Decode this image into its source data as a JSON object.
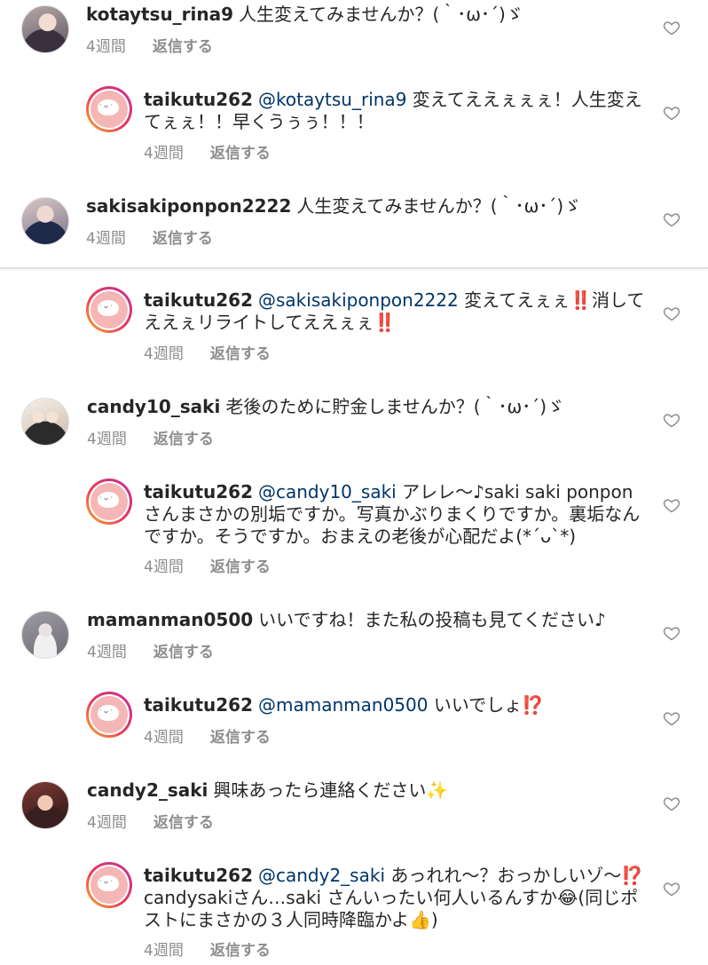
{
  "comments": [
    {
      "username": "kotaytsu_rina9",
      "text": "人生変えてみませんか？(｀･ω･´)ゞ",
      "time": "4週間",
      "reply_label": "返信する"
    },
    {
      "username": "taikutu262",
      "mention": "@kotaytsu_rina9",
      "text": "変えてええぇぇぇ！人生変えてぇぇ！！早くうぅぅ！！！",
      "time": "4週間",
      "reply_label": "返信する"
    },
    {
      "username": "sakisakiponpon2222",
      "text": "人生変えてみませんか？(｀･ω･´)ゞ",
      "time": "4週間",
      "reply_label": "返信する"
    },
    {
      "username": "taikutu262",
      "mention": "@sakisakiponpon2222",
      "text": "変えてえぇぇ‼️消してええぇリライトしてええぇぇ‼️",
      "time": "4週間",
      "reply_label": "返信する"
    },
    {
      "username": "candy10_saki",
      "text": "老後のために貯金しませんか？(｀･ω･´)ゞ",
      "time": "4週間",
      "reply_label": "返信する"
    },
    {
      "username": "taikutu262",
      "mention": "@candy10_saki",
      "text": "アレレ〜♪saki saki ponponさんまさかの別垢ですか。写真かぶりまくりですか。裏垢なんですか。そうですか。おまえの老後が心配だよ(*´ᴗ`*)",
      "time": "4週間",
      "reply_label": "返信する"
    },
    {
      "username": "mamanman0500",
      "text": "いいですね！また私の投稿も見てください♪",
      "time": "4週間",
      "reply_label": "返信する"
    },
    {
      "username": "taikutu262",
      "mention": "@mamanman0500",
      "text": "いいでしょ⁉️",
      "time": "4週間",
      "reply_label": "返信する"
    },
    {
      "username": "candy2_saki",
      "text": "興味あったら連絡ください✨",
      "time": "4週間",
      "reply_label": "返信する"
    },
    {
      "username": "taikutu262",
      "mention": "@candy2_saki",
      "text": "あっれれ〜？おっかしいゾ〜⁉️candysakiさん…saki さんいったい何人いるんすか😂(同じポストにまさかの３人同時降臨かよ👍)",
      "time": "4週間",
      "reply_label": "返信する"
    }
  ]
}
